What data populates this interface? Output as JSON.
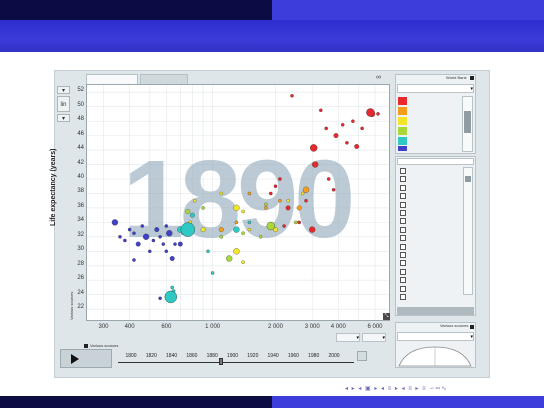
{
  "slide": {
    "nav_symbols": "◂ ▸ ◂ ▣ ▸ ◂ ≡ ▸ ◂ ≡ ▸ ≡ ∽∾∿"
  },
  "app": {
    "tabs": [
      "",
      ""
    ],
    "scale_button": "lin",
    "year_watermark": "1890",
    "y_axis_title": "Life expectancy (years)",
    "y_axis_source": "Various sources",
    "x_axis_source": "Various sources",
    "color_legend_label": "World Bank",
    "size_legend_label": "Various sources",
    "timeline_years": [
      "1800",
      "1820",
      "1840",
      "1860",
      "1880",
      "1900",
      "1920",
      "1940",
      "1960",
      "1980",
      "2000"
    ],
    "color_swatches": [
      "#e8282d",
      "#f39c1e",
      "#f2e52a",
      "#a8d83a",
      "#2ec9c4",
      "#4040c8"
    ]
  },
  "chart_data": {
    "type": "scatter",
    "title": "",
    "xlabel": "",
    "ylabel": "Life expectancy (years)",
    "xscale": "log",
    "xlim": [
      250,
      7000
    ],
    "ylim": [
      20.5,
      53
    ],
    "x_ticks": [
      "300",
      "400",
      "600",
      "1 000",
      "2 000",
      "3 000",
      "4 000",
      "6 000"
    ],
    "y_ticks": [
      "22",
      "24",
      "26",
      "28",
      "30",
      "32",
      "34",
      "36",
      "38",
      "40",
      "42",
      "44",
      "46",
      "48",
      "50",
      "52"
    ],
    "series": [
      {
        "color": "#4040c8",
        "points": [
          [
            340,
            34
          ],
          [
            360,
            32
          ],
          [
            380,
            31.5
          ],
          [
            400,
            33
          ],
          [
            420,
            32.5
          ],
          [
            440,
            31
          ],
          [
            460,
            33.5
          ],
          [
            480,
            32
          ],
          [
            500,
            30
          ],
          [
            520,
            31.5
          ],
          [
            540,
            33
          ],
          [
            560,
            32
          ],
          [
            580,
            31
          ],
          [
            600,
            30
          ],
          [
            620,
            32.5
          ],
          [
            640,
            29
          ],
          [
            660,
            31
          ],
          [
            420,
            28.8
          ],
          [
            560,
            23.5
          ],
          [
            600,
            33.5
          ],
          [
            700,
            31
          ]
        ]
      },
      {
        "color": "#2ec9c4",
        "points": [
          [
            700,
            33
          ],
          [
            720,
            32.5
          ],
          [
            650,
            24.5
          ],
          [
            640,
            25
          ],
          [
            800,
            35
          ],
          [
            950,
            30
          ],
          [
            1000,
            27
          ],
          [
            1300,
            33
          ],
          [
            1500,
            34
          ]
        ]
      },
      {
        "color": "#a8d83a",
        "points": [
          [
            760,
            35.5
          ],
          [
            900,
            36
          ],
          [
            1100,
            32
          ],
          [
            1400,
            32.5
          ],
          [
            1700,
            32
          ],
          [
            1200,
            29
          ],
          [
            2500,
            34
          ],
          [
            1800,
            36.5
          ]
        ]
      },
      {
        "color": "#f2e52a",
        "points": [
          [
            780,
            34
          ],
          [
            820,
            37
          ],
          [
            900,
            33
          ],
          [
            1100,
            38
          ],
          [
            1300,
            36
          ],
          [
            1400,
            35.5
          ],
          [
            1500,
            33
          ],
          [
            2000,
            33
          ],
          [
            2300,
            37
          ],
          [
            2700,
            38
          ],
          [
            1400,
            28.5
          ],
          [
            1300,
            30
          ]
        ]
      },
      {
        "color": "#f39c1e",
        "points": [
          [
            1100,
            33
          ],
          [
            1300,
            34
          ],
          [
            1500,
            38
          ],
          [
            1800,
            36
          ],
          [
            2100,
            37
          ],
          [
            2600,
            36
          ],
          [
            2800,
            38.5
          ]
        ]
      },
      {
        "color": "#e8282d",
        "points": [
          [
            1900,
            38
          ],
          [
            2000,
            39
          ],
          [
            2100,
            40
          ],
          [
            2300,
            36
          ],
          [
            2600,
            34
          ],
          [
            2800,
            37
          ],
          [
            3100,
            42
          ],
          [
            3600,
            40
          ],
          [
            3900,
            46
          ],
          [
            4200,
            47.5
          ],
          [
            4400,
            45
          ],
          [
            4700,
            48
          ],
          [
            5200,
            47
          ],
          [
            5800,
            49
          ],
          [
            6200,
            49
          ],
          [
            2400,
            51.5
          ],
          [
            3500,
            47
          ],
          [
            3300,
            49.5
          ],
          [
            4900,
            44.5
          ],
          [
            3800,
            38.5
          ],
          [
            3000,
            33
          ],
          [
            2200,
            33.5
          ]
        ]
      }
    ]
  }
}
